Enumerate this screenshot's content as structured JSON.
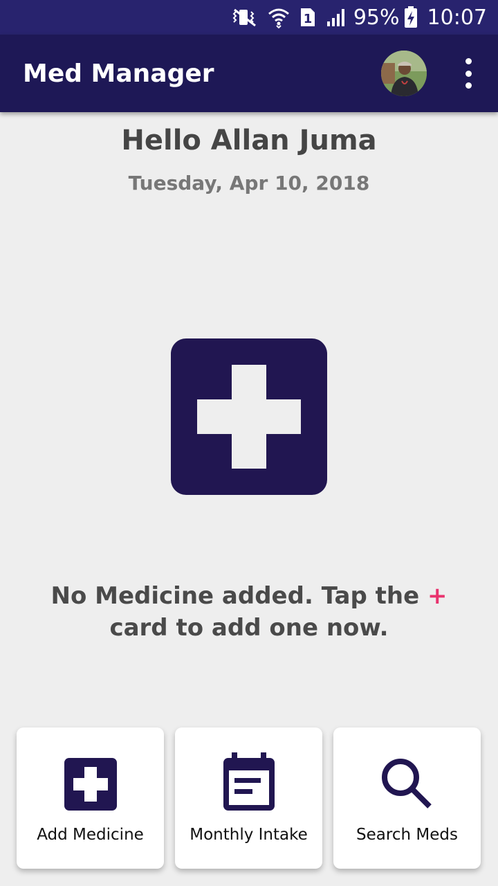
{
  "status_bar": {
    "battery": "95%",
    "time": "10:07",
    "sim_slot": "1",
    "icons": [
      "vibrate-icon",
      "wifi-icon",
      "sim-icon",
      "signal-icon",
      "battery-charging-icon"
    ]
  },
  "toolbar": {
    "title": "Med Manager",
    "avatar_icon": "avatar",
    "menu_icon": "more-vert-icon"
  },
  "main": {
    "greeting": "Hello Allan Juma",
    "date": "Tuesday, Apr 10, 2018",
    "add_card_icon": "medical-cross-icon",
    "empty_message_part1": "No Medicine added. Tap the",
    "empty_message_plus": "+",
    "empty_message_part2": "card to add one now."
  },
  "bottom_cards": [
    {
      "label": "Add Medicine",
      "icon": "add-medicine-icon"
    },
    {
      "label": "Monthly Intake",
      "icon": "calendar-icon"
    },
    {
      "label": "Search Meds",
      "icon": "search-icon"
    }
  ],
  "colors": {
    "status_bar": "#28236e",
    "toolbar": "#1e1856",
    "primary_dark": "#211651",
    "accent": "#e8336e",
    "background": "#eeeeee"
  }
}
